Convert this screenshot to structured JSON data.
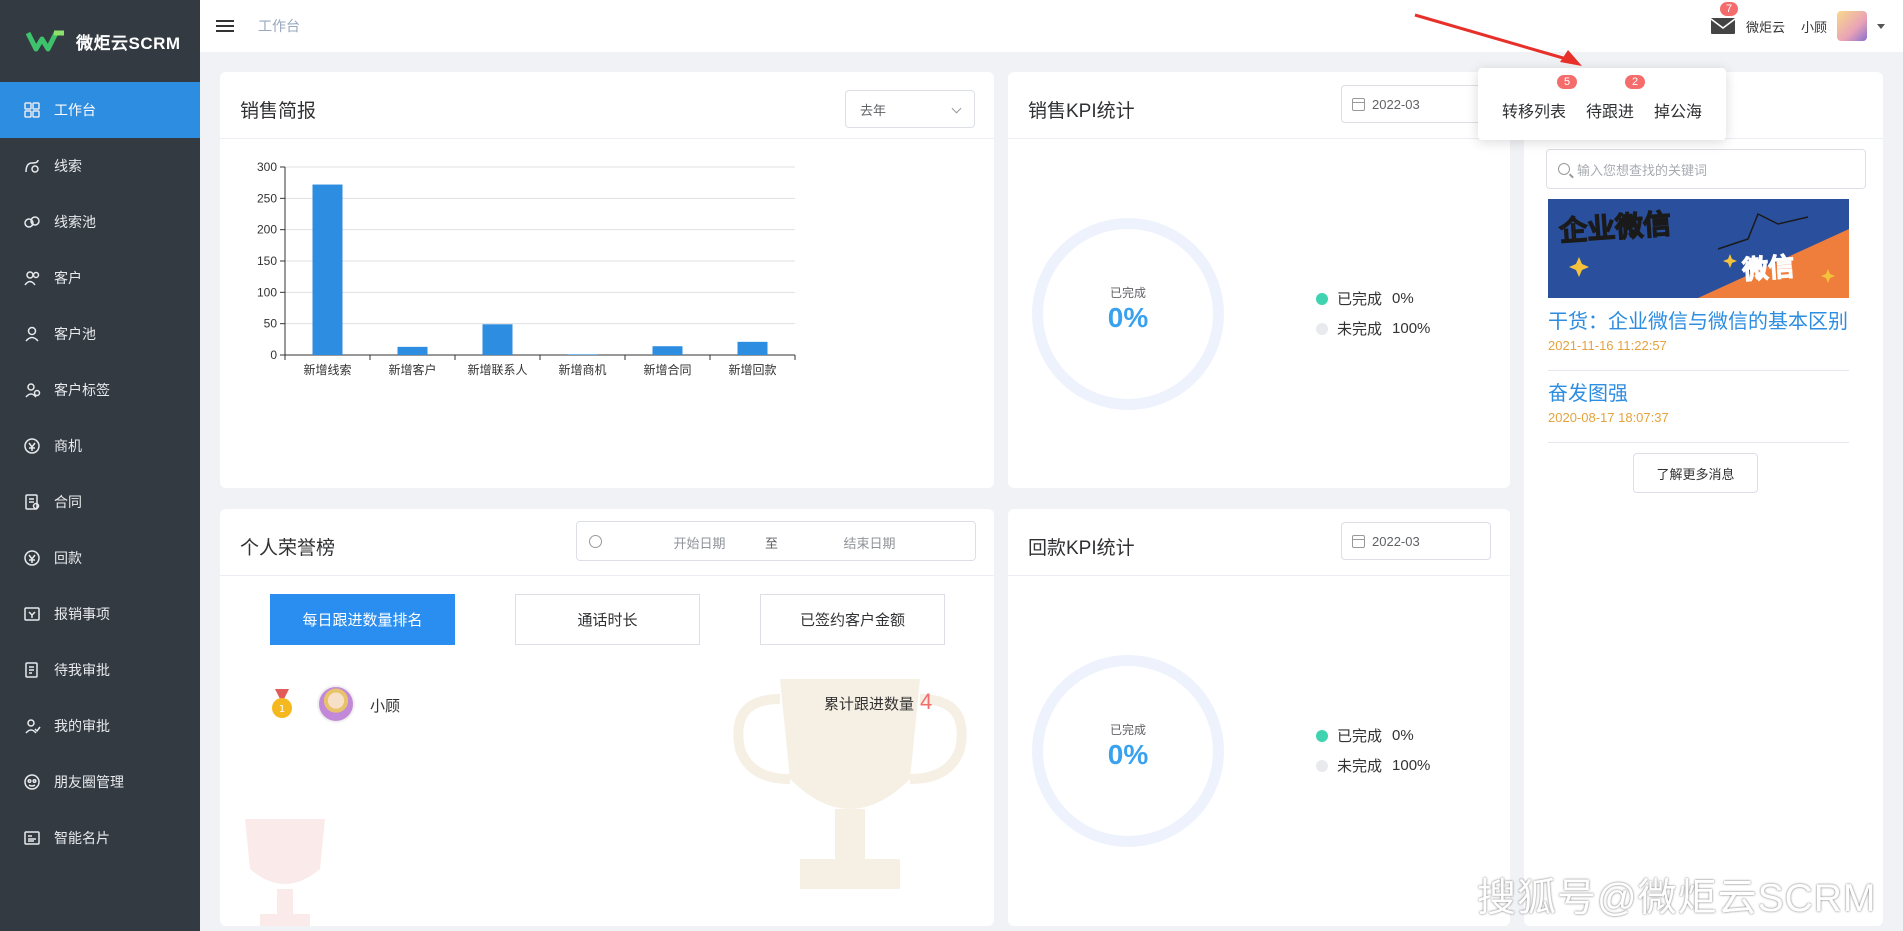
{
  "app": {
    "name": "微炬云SCRM"
  },
  "sidebar": {
    "items": [
      {
        "label": "工作台",
        "icon": "grid-icon",
        "active": true
      },
      {
        "label": "线索",
        "icon": "lead-icon"
      },
      {
        "label": "线索池",
        "icon": "pool-icon"
      },
      {
        "label": "客户",
        "icon": "customers-icon"
      },
      {
        "label": "客户池",
        "icon": "customer-pool-icon"
      },
      {
        "label": "客户标签",
        "icon": "tag-icon"
      },
      {
        "label": "商机",
        "icon": "opportunity-icon"
      },
      {
        "label": "合同",
        "icon": "contract-icon"
      },
      {
        "label": "回款",
        "icon": "payment-icon"
      },
      {
        "label": "报销事项",
        "icon": "reimbursement-icon"
      },
      {
        "label": "待我审批",
        "icon": "pending-approval-icon"
      },
      {
        "label": "我的审批",
        "icon": "my-approval-icon"
      },
      {
        "label": "朋友圈管理",
        "icon": "moments-icon"
      },
      {
        "label": "智能名片",
        "icon": "card-icon"
      }
    ]
  },
  "header": {
    "breadcrumb": "工作台",
    "mail_count": "7",
    "company": "微炬云",
    "user": "小顾"
  },
  "popover": {
    "items": [
      {
        "label": "转移列表",
        "badge": "5"
      },
      {
        "label": "待跟进",
        "badge": "2"
      },
      {
        "label": "掉公海",
        "badge": ""
      }
    ]
  },
  "sales_report": {
    "title": "销售简报",
    "period": "去年"
  },
  "chart_data": {
    "type": "bar",
    "categories": [
      "新增线索",
      "新增客户",
      "新增联系人",
      "新增商机",
      "新增合同",
      "新增回款"
    ],
    "values": [
      272,
      13,
      49,
      1,
      14,
      21
    ],
    "ylim": [
      0,
      300
    ],
    "yticks": [
      0,
      50,
      100,
      150,
      200,
      250,
      300
    ],
    "color": "#2d8de0",
    "grid": true
  },
  "sales_kpi": {
    "title": "销售KPI统计",
    "date": "2022-03",
    "ring_label": "已完成",
    "ring_value": "0%",
    "legend": [
      {
        "label": "已完成",
        "value": "0%",
        "color": "#3fd3b0"
      },
      {
        "label": "未完成",
        "value": "100%",
        "color": "#e8eaed"
      }
    ]
  },
  "payment_kpi": {
    "title": "回款KPI统计",
    "date": "2022-03",
    "ring_label": "已完成",
    "ring_value": "0%",
    "legend": [
      {
        "label": "已完成",
        "value": "0%",
        "color": "#3fd3b0"
      },
      {
        "label": "未完成",
        "value": "100%",
        "color": "#e8eaed"
      }
    ]
  },
  "honor": {
    "title": "个人荣誉榜",
    "start_placeholder": "开始日期",
    "separator": "至",
    "end_placeholder": "结束日期",
    "tabs": [
      "每日跟进数量排名",
      "通话时长",
      "已签约客户金额"
    ],
    "rank_no": "1",
    "entry": {
      "name": "小顾",
      "metric": "累计跟进数量",
      "count": "4"
    }
  },
  "messages": {
    "search_placeholder": "输入您想查找的关键词",
    "banner_text_1": "企业微信",
    "banner_text_2": "微信",
    "articles": [
      {
        "title": "干货：企业微信与微信的基本区别",
        "date": "2021-11-16 11:22:57"
      },
      {
        "title": "奋发图强",
        "date": "2020-08-17 18:07:37"
      }
    ],
    "more_label": "了解更多消息"
  },
  "watermark": "搜狐号@微炬云SCRM"
}
